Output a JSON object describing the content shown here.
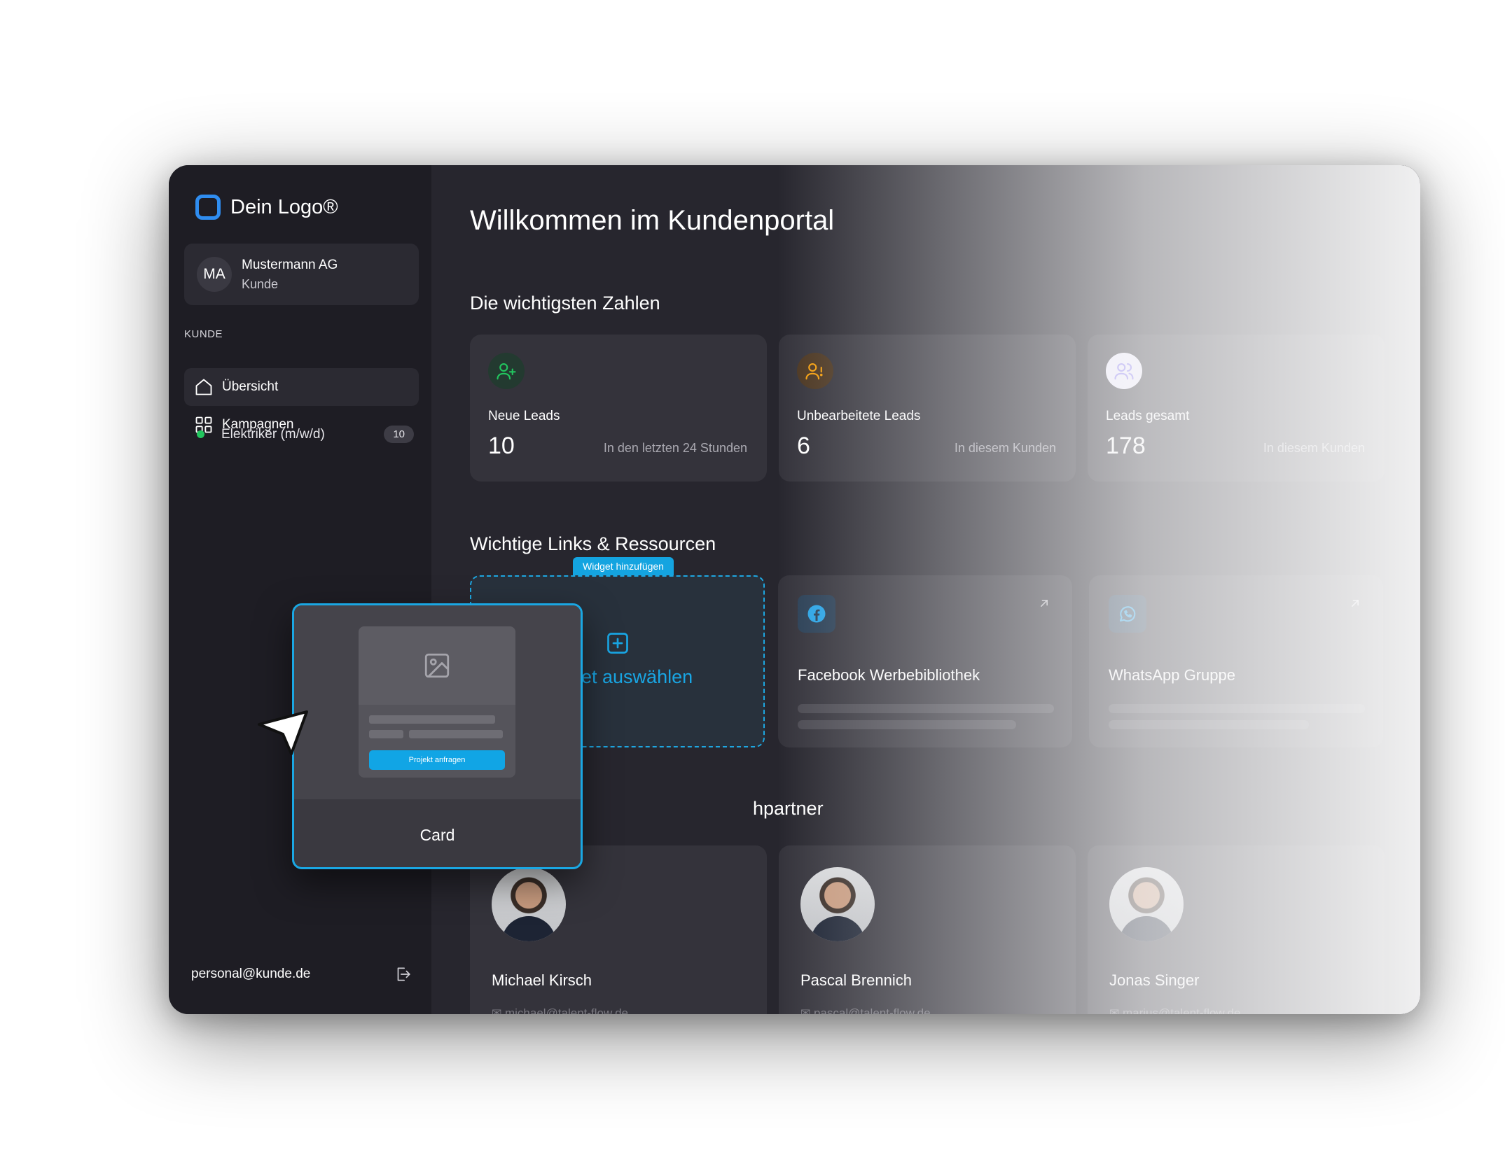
{
  "brand": {
    "logo_text": "Dein Logo®",
    "accent": "#2f8df0"
  },
  "account": {
    "initials": "MA",
    "name": "Mustermann AG",
    "role": "Kunde"
  },
  "sidebar": {
    "section_label": "KUNDE",
    "items": [
      {
        "label": "Übersicht",
        "icon": "home-icon",
        "active": true
      },
      {
        "label": "Kampagnen",
        "icon": "grid-icon",
        "active": false
      }
    ],
    "campaign": {
      "label": "Elektriker (m/w/d)",
      "count": "10"
    },
    "email": "personal@kunde.de"
  },
  "main": {
    "title": "Willkommen im Kundenportal",
    "stats_heading": "Die wichtigsten Zahlen",
    "stats": [
      {
        "label": "Neue Leads",
        "value": "10",
        "note": "In den letzten 24 Stunden",
        "icon": "user-plus-icon",
        "color": "#22c55e"
      },
      {
        "label": "Unbearbeitete Leads",
        "value": "6",
        "note": "In diesem Kunden",
        "icon": "user-alert-icon",
        "color": "#f59e0b"
      },
      {
        "label": "Leads gesamt",
        "value": "178",
        "note": "In diesem Kunden",
        "icon": "users-icon",
        "color": "#8b7cf6"
      }
    ],
    "links_heading": "Wichtige Links & Ressourcen",
    "widget": {
      "tag": "Widget hinzufügen",
      "text": "et auswählen"
    },
    "links": [
      {
        "title": "Facebook Werbebibliothek",
        "icon": "facebook-icon"
      },
      {
        "title": "WhatsApp Gruppe",
        "icon": "whatsapp-icon"
      }
    ],
    "contacts_heading": "hpartner",
    "contacts": [
      {
        "name": "Michael Kirsch",
        "email": "michael@talent-flow.de"
      },
      {
        "name": "Pascal Brennich",
        "email": "pascal@talent-flow.de"
      },
      {
        "name": "Jonas Singer",
        "email": "marius@talent-flow.de"
      }
    ]
  },
  "popup": {
    "button_label": "Projekt anfragen",
    "caption": "Card"
  }
}
